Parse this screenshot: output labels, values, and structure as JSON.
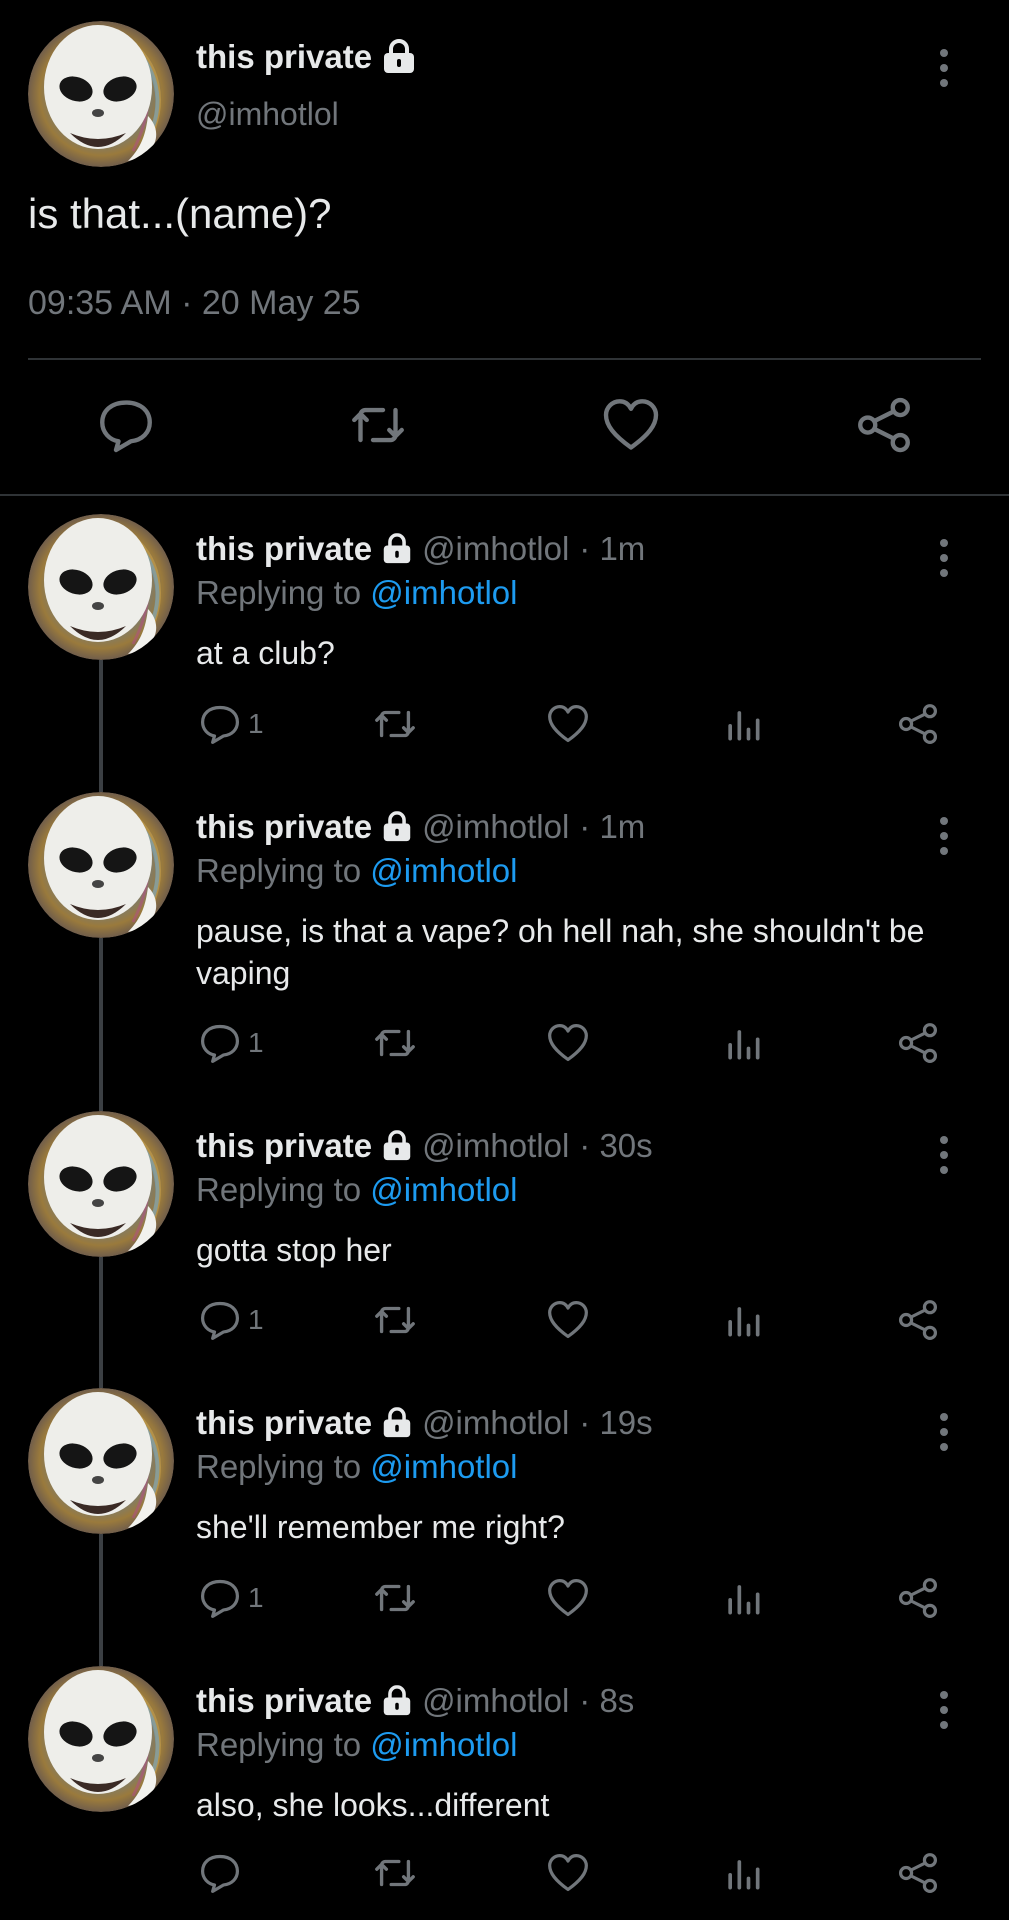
{
  "main_tweet": {
    "display_name": "this private",
    "handle": "@imhotlol",
    "text": "is that...(name)?",
    "timestamp": "09:35 AM · 20 May 25",
    "icons": [
      "lock-icon",
      "more-vertical-icon",
      "reply-icon",
      "retweet-icon",
      "like-icon",
      "share-icon"
    ]
  },
  "replies": [
    {
      "display_name": "this private",
      "handle": "@imhotlol",
      "time": "· 1m",
      "replying_prefix": "Replying to",
      "replying_to": "@imhotlol",
      "text": "at a club?",
      "reply_count": "1"
    },
    {
      "display_name": "this private",
      "handle": "@imhotlol",
      "time": "· 1m",
      "replying_prefix": "Replying to",
      "replying_to": "@imhotlol",
      "text": "pause, is that a vape? oh hell nah, she shouldn't be vaping",
      "reply_count": "1"
    },
    {
      "display_name": "this private",
      "handle": "@imhotlol",
      "time": "· 30s",
      "replying_prefix": "Replying to",
      "replying_to": "@imhotlol",
      "text": "gotta stop her",
      "reply_count": "1"
    },
    {
      "display_name": "this private",
      "handle": "@imhotlol",
      "time": "· 19s",
      "replying_prefix": "Replying to",
      "replying_to": "@imhotlol",
      "text": "she'll remember me right?",
      "reply_count": "1"
    },
    {
      "display_name": "this private",
      "handle": "@imhotlol",
      "time": "· 8s",
      "replying_prefix": "Replying to",
      "replying_to": "@imhotlol",
      "text": "also, she looks...different",
      "reply_count": ""
    }
  ],
  "colors": {
    "background": "#000000",
    "text": "#e7e9ea",
    "muted": "#71767b",
    "link": "#1d9bf0",
    "divider": "#2f3336"
  }
}
